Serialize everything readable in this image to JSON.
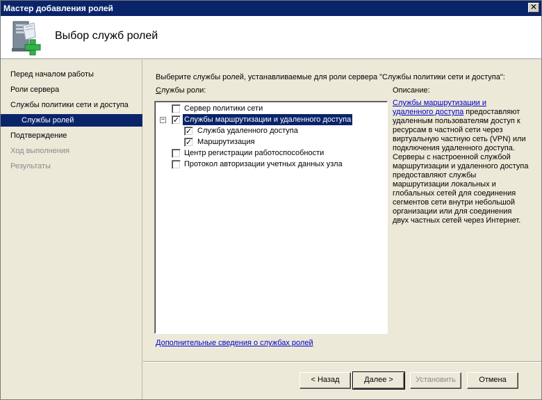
{
  "window": {
    "title": "Мастер добавления ролей",
    "close_glyph": "✕"
  },
  "header": {
    "title": "Выбор служб ролей",
    "icon": "server-roles-add-icon"
  },
  "nav": {
    "items": [
      {
        "label": "Перед началом работы",
        "state": "normal"
      },
      {
        "label": "Роли сервера",
        "state": "normal"
      },
      {
        "label": "Службы политики сети и доступа",
        "state": "normal"
      },
      {
        "label": "Службы ролей",
        "state": "selected"
      },
      {
        "label": "Подтверждение",
        "state": "normal"
      },
      {
        "label": "Ход выполнения",
        "state": "disabled"
      },
      {
        "label": "Результаты",
        "state": "disabled"
      }
    ]
  },
  "main": {
    "instruction": "Выберите службы ролей, устанавливаемые для роли сервера \"Службы политики сети и доступа\":",
    "services_label_prefix": "С",
    "services_label_rest": "лужбы роли:",
    "tree": [
      {
        "label": "Сервер политики сети",
        "checked": false,
        "level": 0,
        "expander": ""
      },
      {
        "label": "Службы маршрутизации и удаленного доступа",
        "checked": true,
        "level": 0,
        "expander": "−",
        "highlight": true
      },
      {
        "label": "Служба удаленного доступа",
        "checked": true,
        "level": 1,
        "expander": ""
      },
      {
        "label": "Маршрутизация",
        "checked": true,
        "level": 1,
        "expander": ""
      },
      {
        "label": "Центр регистрации работоспособности",
        "checked": false,
        "level": 0,
        "expander": ""
      },
      {
        "label": "Протокол авторизации учетных данных узла",
        "checked": false,
        "level": 0,
        "expander": ""
      }
    ],
    "check_glyph": "✓",
    "description_title": "Описание:",
    "description_link": "Службы маршрутизации и удаленного доступа",
    "description_text": " предоставляют удаленным пользователям доступ к ресурсам в частной сети через виртуальную частную сеть (VPN) или подключения удаленного доступа. Серверы с настроенной службой маршрутизации и удаленного доступа предоставляют службы маршрутизации локальных и глобальных сетей для соединения сегментов сети внутри небольшой организации или для соединения двух частных сетей через Интернет.",
    "more_link": "Дополнительные сведения о службах ролей"
  },
  "buttons": {
    "back": "< Назад",
    "next": "Далее >",
    "install": "Установить",
    "cancel": "Отмена"
  },
  "colors": {
    "selection": "#0a246a",
    "link": "#0000cc",
    "disabled_text": "#8a8a8a"
  }
}
